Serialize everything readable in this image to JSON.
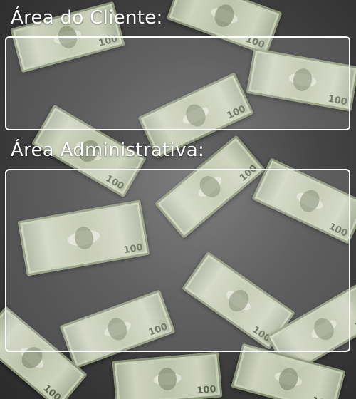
{
  "sections": [
    {
      "title": "Área do Cliente:"
    },
    {
      "title": "Área Administrativa:"
    }
  ],
  "background": {
    "subject": "falling-dollar-bills",
    "base_color": "#3a3a3a",
    "bill_color": "#d7dcc7"
  },
  "panel": {
    "border_color": "#ffffff",
    "fill": "rgba(255,255,255,0.14)"
  }
}
